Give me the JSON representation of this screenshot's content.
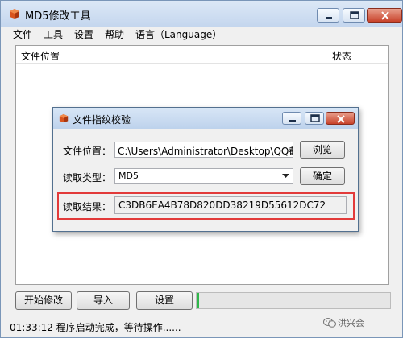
{
  "window": {
    "title": "MD5修改工具",
    "icon": "orange-cube-icon"
  },
  "menu": [
    "文件",
    "工具",
    "设置",
    "帮助",
    "语言（Language）"
  ],
  "list": {
    "columns": [
      "文件位置",
      "状态"
    ],
    "rows": []
  },
  "dialog": {
    "title": "文件指纹校验",
    "file_label": "文件位置：",
    "file_value": "C:\\Users\\Administrator\\Desktop\\QQ截",
    "browse_label": "浏览",
    "type_label": "读取类型：",
    "type_value": "MD5",
    "confirm_label": "确定",
    "result_label": "读取结果：",
    "result_value": "C3DB6EA4B78D820DD38219D55612DC72",
    "highlight_color": "#e23a3a"
  },
  "buttons": {
    "start": "开始修改",
    "import": "导入",
    "settings": "设置"
  },
  "progress": {
    "value": 0.01,
    "color": "#2fb84a"
  },
  "status": {
    "text": "01:33:12 程序启动完成，等待操作......"
  },
  "watermark": {
    "text": "洪兴会",
    "icon": "wechat-icon"
  }
}
